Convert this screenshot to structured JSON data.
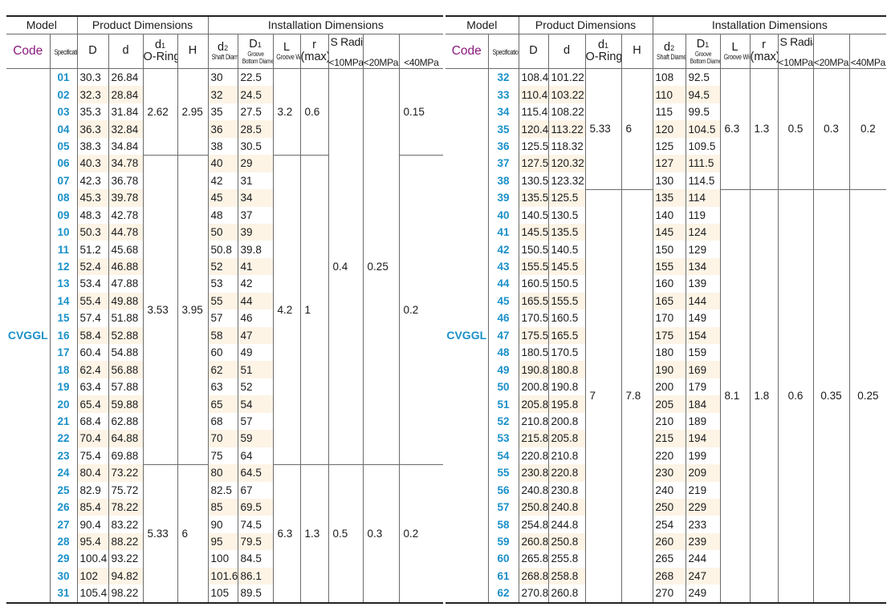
{
  "headers": {
    "model": "Model",
    "product_dimensions": "Product Dimensions",
    "installation_dimensions": "Installation Dimensions",
    "code": "Code",
    "specification": "Specification",
    "D": "D",
    "d": "d",
    "d1_main": "d",
    "d1_sub": "1",
    "d1_note": "O-Ring",
    "H": "H",
    "d2_main": "d",
    "d2_sub": "2",
    "d2_note": "Shaft Diameter",
    "D1_main": "D",
    "D1_sub": "1",
    "D1_note1": "Groove",
    "D1_note2": "Bottom Diameter",
    "L": "L",
    "L_note": "Groove Width",
    "r": "r",
    "r_note": "(max)",
    "radial_clearance": "S Radial Clearance(max)",
    "p10": "<10MPa",
    "p20": "<20MPa",
    "p40": "<40MPa"
  },
  "model_code": "CVGGL",
  "left_rows": [
    {
      "no": "01",
      "D": "30.3",
      "d": "26.84",
      "d2": "30",
      "D1": "22.5"
    },
    {
      "no": "02",
      "D": "32.3",
      "d": "28.84",
      "d2": "32",
      "D1": "24.5"
    },
    {
      "no": "03",
      "D": "35.3",
      "d": "31.84",
      "d2": "35",
      "D1": "27.5"
    },
    {
      "no": "04",
      "D": "36.3",
      "d": "32.84",
      "d2": "36",
      "D1": "28.5"
    },
    {
      "no": "05",
      "D": "38.3",
      "d": "34.84",
      "d2": "38",
      "D1": "30.5"
    },
    {
      "no": "06",
      "D": "40.3",
      "d": "34.78",
      "d2": "40",
      "D1": "29"
    },
    {
      "no": "07",
      "D": "42.3",
      "d": "36.78",
      "d2": "42",
      "D1": "31"
    },
    {
      "no": "08",
      "D": "45.3",
      "d": "39.78",
      "d2": "45",
      "D1": "34"
    },
    {
      "no": "09",
      "D": "48.3",
      "d": "42.78",
      "d2": "48",
      "D1": "37"
    },
    {
      "no": "10",
      "D": "50.3",
      "d": "44.78",
      "d2": "50",
      "D1": "39"
    },
    {
      "no": "11",
      "D": "51.2",
      "d": "45.68",
      "d2": "50.8",
      "D1": "39.8"
    },
    {
      "no": "12",
      "D": "52.4",
      "d": "46.88",
      "d2": "52",
      "D1": "41"
    },
    {
      "no": "13",
      "D": "53.4",
      "d": "47.88",
      "d2": "53",
      "D1": "42"
    },
    {
      "no": "14",
      "D": "55.4",
      "d": "49.88",
      "d2": "55",
      "D1": "44"
    },
    {
      "no": "15",
      "D": "57.4",
      "d": "51.88",
      "d2": "57",
      "D1": "46"
    },
    {
      "no": "16",
      "D": "58.4",
      "d": "52.88",
      "d2": "58",
      "D1": "47"
    },
    {
      "no": "17",
      "D": "60.4",
      "d": "54.88",
      "d2": "60",
      "D1": "49"
    },
    {
      "no": "18",
      "D": "62.4",
      "d": "56.88",
      "d2": "62",
      "D1": "51"
    },
    {
      "no": "19",
      "D": "63.4",
      "d": "57.88",
      "d2": "63",
      "D1": "52"
    },
    {
      "no": "20",
      "D": "65.4",
      "d": "59.88",
      "d2": "65",
      "D1": "54"
    },
    {
      "no": "21",
      "D": "68.4",
      "d": "62.88",
      "d2": "68",
      "D1": "57"
    },
    {
      "no": "22",
      "D": "70.4",
      "d": "64.88",
      "d2": "70",
      "D1": "59"
    },
    {
      "no": "23",
      "D": "75.4",
      "d": "69.88",
      "d2": "75",
      "D1": "64"
    },
    {
      "no": "24",
      "D": "80.4",
      "d": "73.22",
      "d2": "80",
      "D1": "64.5"
    },
    {
      "no": "25",
      "D": "82.9",
      "d": "75.72",
      "d2": "82.5",
      "D1": "67"
    },
    {
      "no": "26",
      "D": "85.4",
      "d": "78.22",
      "d2": "85",
      "D1": "69.5"
    },
    {
      "no": "27",
      "D": "90.4",
      "d": "83.22",
      "d2": "90",
      "D1": "74.5"
    },
    {
      "no": "28",
      "D": "95.4",
      "d": "88.22",
      "d2": "95",
      "D1": "79.5"
    },
    {
      "no": "29",
      "D": "100.4",
      "d": "93.22",
      "d2": "100",
      "D1": "84.5"
    },
    {
      "no": "30",
      "D": "102",
      "d": "94.82",
      "d2": "101.6",
      "D1": "86.1"
    },
    {
      "no": "31",
      "D": "105.4",
      "d": "98.22",
      "d2": "105",
      "D1": "89.5"
    }
  ],
  "left_groups": {
    "d1": [
      "2.62",
      "3.53",
      "5.33"
    ],
    "H": [
      "2.95",
      "3.95",
      "6"
    ],
    "L": [
      "3.2",
      "4.2",
      "6.3"
    ],
    "r": [
      "0.6",
      "1",
      "1.3"
    ],
    "p10_mid": "0.4",
    "p20_mid": "0.25",
    "p10_bot": "0.5",
    "p20_bot": "0.3",
    "p40": [
      "0.15",
      "0.2",
      "0.2"
    ]
  },
  "right_rows": [
    {
      "no": "32",
      "D": "108.4",
      "d": "101.22",
      "d2": "108",
      "D1": "92.5"
    },
    {
      "no": "33",
      "D": "110.4",
      "d": "103.22",
      "d2": "110",
      "D1": "94.5"
    },
    {
      "no": "34",
      "D": "115.4",
      "d": "108.22",
      "d2": "115",
      "D1": "99.5"
    },
    {
      "no": "35",
      "D": "120.4",
      "d": "113.22",
      "d2": "120",
      "D1": "104.5"
    },
    {
      "no": "36",
      "D": "125.5",
      "d": "118.32",
      "d2": "125",
      "D1": "109.5"
    },
    {
      "no": "37",
      "D": "127.5",
      "d": "120.32",
      "d2": "127",
      "D1": "111.5"
    },
    {
      "no": "38",
      "D": "130.5",
      "d": "123.32",
      "d2": "130",
      "D1": "114.5"
    },
    {
      "no": "39",
      "D": "135.5",
      "d": "125.5",
      "d2": "135",
      "D1": "114"
    },
    {
      "no": "40",
      "D": "140.5",
      "d": "130.5",
      "d2": "140",
      "D1": "119"
    },
    {
      "no": "41",
      "D": "145.5",
      "d": "135.5",
      "d2": "145",
      "D1": "124"
    },
    {
      "no": "42",
      "D": "150.5",
      "d": "140.5",
      "d2": "150",
      "D1": "129"
    },
    {
      "no": "43",
      "D": "155.5",
      "d": "145.5",
      "d2": "155",
      "D1": "134"
    },
    {
      "no": "44",
      "D": "160.5",
      "d": "150.5",
      "d2": "160",
      "D1": "139"
    },
    {
      "no": "45",
      "D": "165.5",
      "d": "155.5",
      "d2": "165",
      "D1": "144"
    },
    {
      "no": "46",
      "D": "170.5",
      "d": "160.5",
      "d2": "170",
      "D1": "149"
    },
    {
      "no": "47",
      "D": "175.5",
      "d": "165.5",
      "d2": "175",
      "D1": "154"
    },
    {
      "no": "48",
      "D": "180.5",
      "d": "170.5",
      "d2": "180",
      "D1": "159"
    },
    {
      "no": "49",
      "D": "190.8",
      "d": "180.8",
      "d2": "190",
      "D1": "169"
    },
    {
      "no": "50",
      "D": "200.8",
      "d": "190.8",
      "d2": "200",
      "D1": "179"
    },
    {
      "no": "51",
      "D": "205.8",
      "d": "195.8",
      "d2": "205",
      "D1": "184"
    },
    {
      "no": "52",
      "D": "210.8",
      "d": "200.8",
      "d2": "210",
      "D1": "189"
    },
    {
      "no": "53",
      "D": "215.8",
      "d": "205.8",
      "d2": "215",
      "D1": "194"
    },
    {
      "no": "54",
      "D": "220.8",
      "d": "210.8",
      "d2": "220",
      "D1": "199"
    },
    {
      "no": "55",
      "D": "230.8",
      "d": "220.8",
      "d2": "230",
      "D1": "209"
    },
    {
      "no": "56",
      "D": "240.8",
      "d": "230.8",
      "d2": "240",
      "D1": "219"
    },
    {
      "no": "57",
      "D": "250.8",
      "d": "240.8",
      "d2": "250",
      "D1": "229"
    },
    {
      "no": "58",
      "D": "254.8",
      "d": "244.8",
      "d2": "254",
      "D1": "233"
    },
    {
      "no": "59",
      "D": "260.8",
      "d": "250.8",
      "d2": "260",
      "D1": "239"
    },
    {
      "no": "60",
      "D": "265.8",
      "d": "255.8",
      "d2": "265",
      "D1": "244"
    },
    {
      "no": "61",
      "D": "268.8",
      "d": "258.8",
      "d2": "268",
      "D1": "247"
    },
    {
      "no": "62",
      "D": "270.8",
      "d": "260.8",
      "d2": "270",
      "D1": "249"
    }
  ],
  "right_groups": {
    "d1": [
      "5.33",
      "7"
    ],
    "H": [
      "6",
      "7.8"
    ],
    "L": [
      "6.3",
      "8.1"
    ],
    "r": [
      "1.3",
      "1.8"
    ],
    "p10": [
      "0.5",
      "0.6"
    ],
    "p20": [
      "0.3",
      "0.35"
    ],
    "p40": [
      "0.2",
      "0.25"
    ]
  },
  "colors": {
    "code_blue": "#1a90c8",
    "code_header_purple": "#8a1a7e",
    "stripe": "#fdf4e6"
  }
}
